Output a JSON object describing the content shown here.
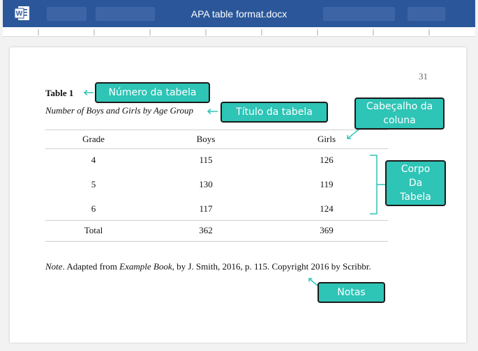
{
  "titlebar": {
    "app_icon": "word-icon",
    "document_title": "APA table format.docx",
    "background": "#2b579a"
  },
  "document": {
    "page_number": "31",
    "table_number": "Table 1",
    "table_title": "Number of Boys and Girls by Age Group",
    "headers": [
      "Grade",
      "Boys",
      "Girls"
    ],
    "rows": [
      [
        "4",
        "115",
        "126"
      ],
      [
        "5",
        "130",
        "119"
      ],
      [
        "6",
        "117",
        "124"
      ]
    ],
    "total_row": [
      "Total",
      "362",
      "369"
    ],
    "note": {
      "label": "Note",
      "text_1": ". Adapted from ",
      "book": "Example Book",
      "text_2": ", by J. Smith, 2016, p. 115. Copyright 2016 by Scribbr."
    }
  },
  "callouts": {
    "table_number": "Número da tabela",
    "table_title": "Título da tabela",
    "column_header_1": "Cabeçalho da",
    "column_header_2": "coluna",
    "table_body_1": "Corpo",
    "table_body_2": "Da",
    "table_body_3": "Tabela",
    "notes": "Notas",
    "color": "#2ec4b6"
  }
}
